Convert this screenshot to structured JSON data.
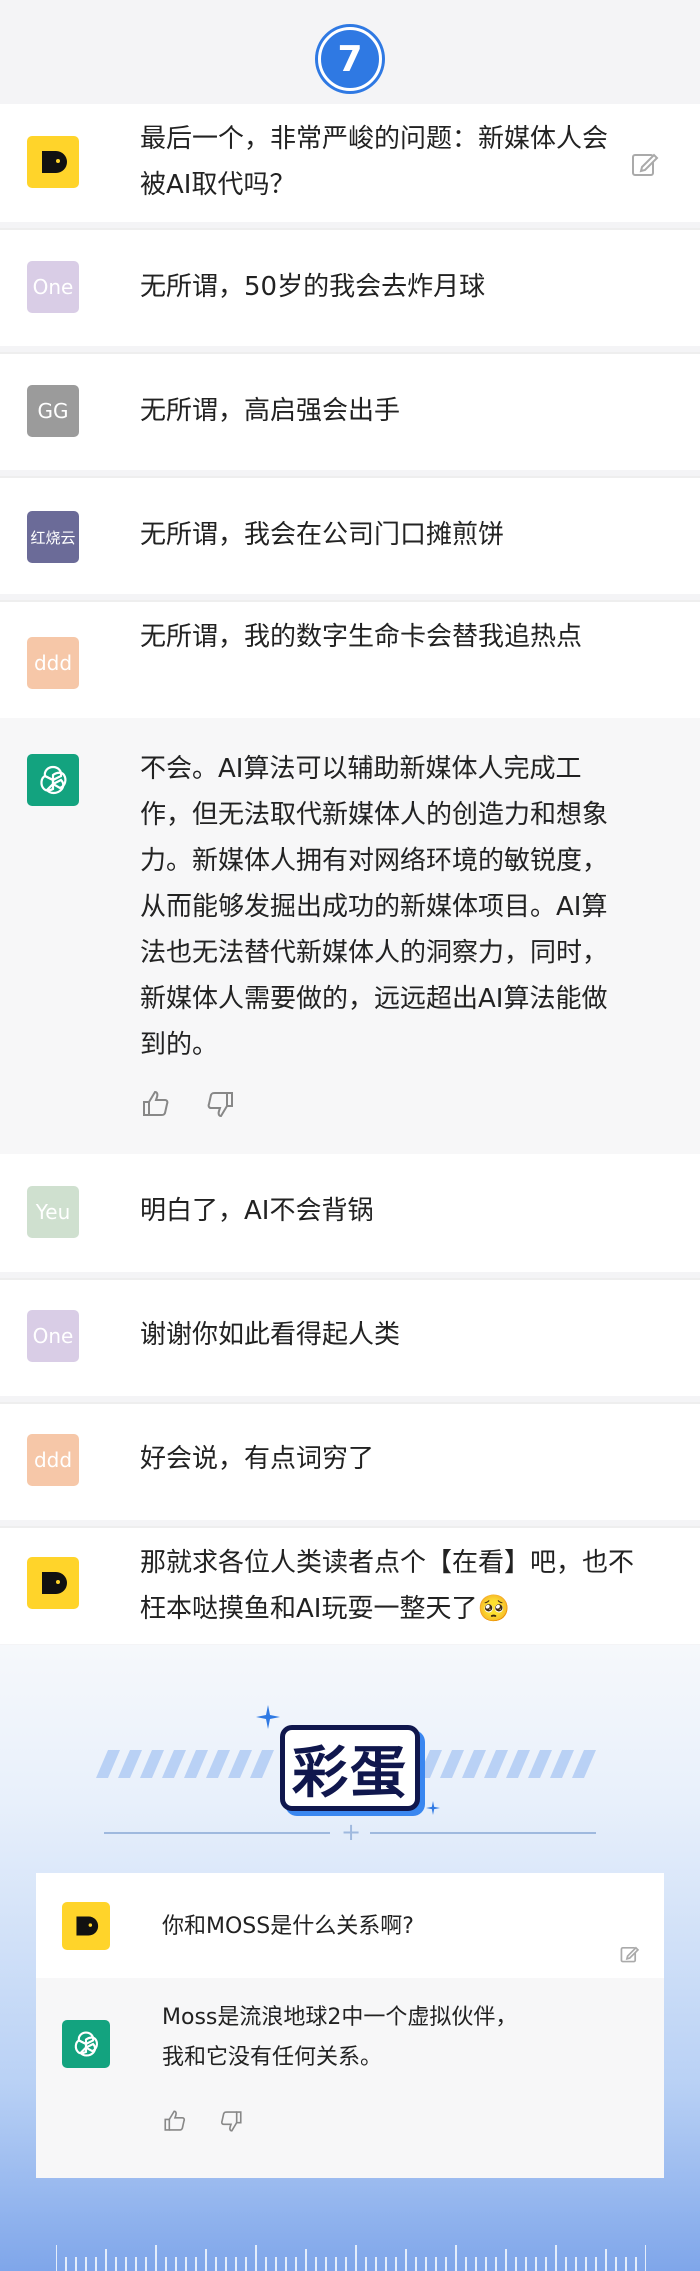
{
  "badge": {
    "number": "7"
  },
  "messages": [
    {
      "avatar_text": "",
      "avatar_icon": "chatdog-logo-icon",
      "text": "最后一个，非常严峻的问题：新媒体人会被AI取代吗？",
      "editable": true
    },
    {
      "avatar_text": "One",
      "text": "无所谓，50岁的我会去炸月球"
    },
    {
      "avatar_text": "GG",
      "text": "无所谓，高启强会出手"
    },
    {
      "avatar_text": "红烧云",
      "text": "无所谓，我会在公司门口摊煎饼"
    },
    {
      "avatar_text": "ddd",
      "text": "无所谓，我的数字生命卡会替我追热点"
    },
    {
      "avatar_text": "",
      "avatar_icon": "openai-logo-icon",
      "text": "不会。AI算法可以辅助新媒体人完成工作，但无法取代新媒体人的创造力和想象力。新媒体人拥有对网络环境的敏锐度，从而能够发掘出成功的新媒体项目。AI算法也无法替代新媒体人的洞察力，同时，新媒体人需要做的，远远超出AI算法能做到的。"
    },
    {
      "avatar_text": "Yeu",
      "text": "明白了，AI不会背锅"
    },
    {
      "avatar_text": "One",
      "text": "谢谢你如此看得起人类"
    },
    {
      "avatar_text": "ddd",
      "text": "好会说，有点词穷了"
    },
    {
      "avatar_text": "",
      "avatar_icon": "chatdog-logo-icon",
      "text": "那就求各位人类读者点个【在看】吧，也不枉本哒摸鱼和AI玩耍一整天了🥺"
    }
  ],
  "egg": {
    "title": "彩蛋",
    "question": "你和MOSS是什么关系啊?",
    "answer_line1": "Moss是流浪地球2中一个虚拟伙伴，",
    "answer_line2": "我和它没有任何关系。"
  },
  "colors": {
    "accent_blue": "#2f79e3",
    "logo_yellow": "#ffd42a",
    "openai_green": "#13a37f",
    "avatar_one": "#d9cde6",
    "avatar_gg": "#9b9b9b",
    "avatar_hsy": "#6b6b98",
    "avatar_ddd": "#f6c7a8",
    "avatar_yeu": "#cfe0cf"
  }
}
